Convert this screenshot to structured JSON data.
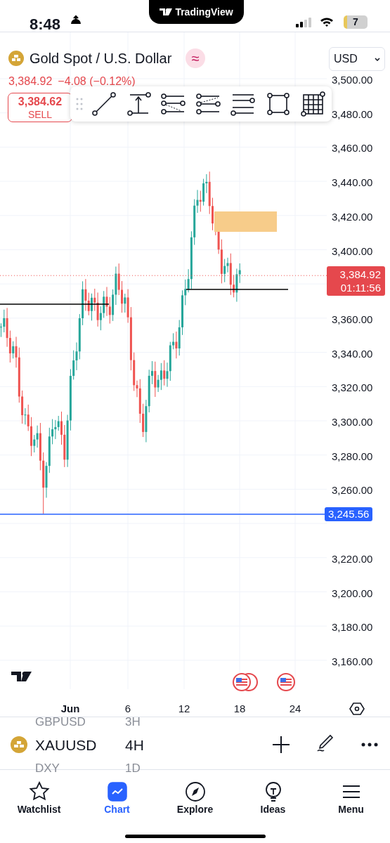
{
  "status_bar": {
    "time": "8:48",
    "app_pill": "TradingView",
    "battery": "7"
  },
  "header": {
    "title": "Gold Spot / U.S. Dollar",
    "badge": "≈",
    "quote": "3,384.92",
    "change": "−4.08 (−0.12%)",
    "currency": "USD"
  },
  "sell_button": {
    "price": "3,384.62",
    "label": "SELL"
  },
  "chart": {
    "price_ticks": [
      "3,500.00",
      "3,480.00",
      "3,460.00",
      "3,440.00",
      "3,420.00",
      "3,400.00",
      "3,360.00",
      "3,340.00",
      "3,320.00",
      "3,300.00",
      "3,280.00",
      "3,260.00",
      "3,220.00",
      "3,200.00",
      "3,180.00",
      "3,160.00"
    ],
    "date_ticks": [
      {
        "label": "Jun",
        "kind": "month"
      },
      {
        "label": "6",
        "kind": "day"
      },
      {
        "label": "12",
        "kind": "day"
      },
      {
        "label": "18",
        "kind": "day"
      },
      {
        "label": "24",
        "kind": "day"
      }
    ],
    "last_price": {
      "price": "3,384.92",
      "countdown": "01:11:56"
    },
    "line_label": "3,245.56"
  },
  "symbol_bar": {
    "previous": {
      "symbol": "GBPUSD",
      "interval": "3H"
    },
    "current": {
      "symbol": "XAUUSD",
      "interval": "4H"
    },
    "next": {
      "symbol": "DXY",
      "interval": "1D"
    }
  },
  "tabs": [
    {
      "label": "Watchlist",
      "selected": false
    },
    {
      "label": "Chart",
      "selected": true
    },
    {
      "label": "Explore",
      "selected": false
    },
    {
      "label": "Ideas",
      "selected": false
    },
    {
      "label": "Menu",
      "selected": false
    }
  ]
}
